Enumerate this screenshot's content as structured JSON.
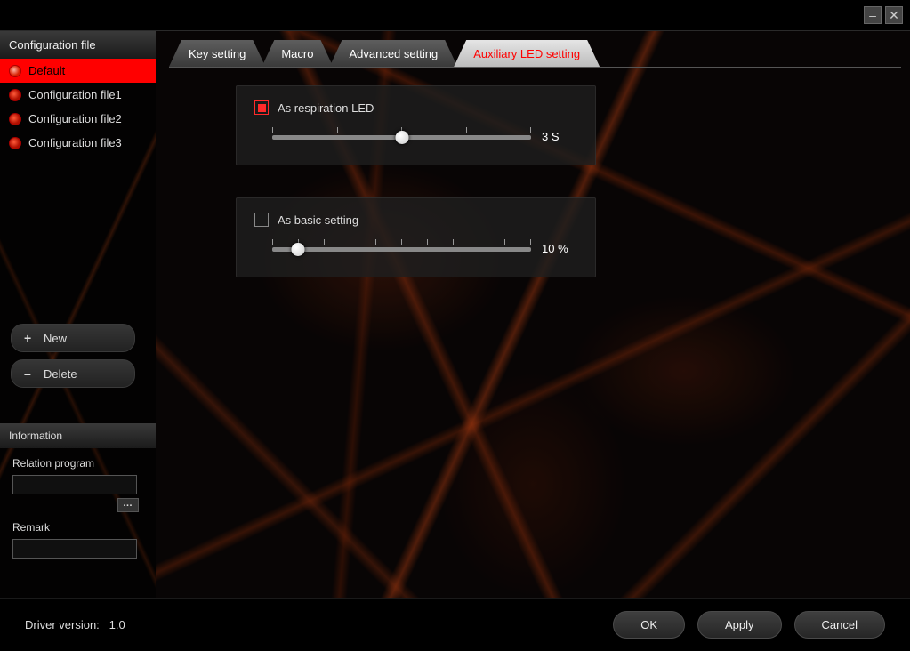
{
  "titlebar": {
    "minimize": "–",
    "close": "✕"
  },
  "sidebar": {
    "header": "Configuration file",
    "items": [
      {
        "label": "Default"
      },
      {
        "label": "Configuration file1"
      },
      {
        "label": "Configuration file2"
      },
      {
        "label": "Configuration file3"
      }
    ],
    "new_label": "New",
    "delete_label": "Delete",
    "info_header": "Information",
    "relation_label": "Relation program",
    "relation_value": "",
    "more": "…",
    "remark_label": "Remark",
    "remark_value": ""
  },
  "tabs": [
    {
      "label": "Key setting"
    },
    {
      "label": "Macro"
    },
    {
      "label": "Advanced setting"
    },
    {
      "label": "Auxiliary LED setting"
    }
  ],
  "led": {
    "respiration_label": "As respiration LED",
    "respiration_checked": true,
    "respiration_value": "3 S",
    "respiration_pct": 50,
    "respiration_ticks": 5,
    "basic_label": "As basic setting",
    "basic_checked": false,
    "basic_value": "10 %",
    "basic_pct": 10,
    "basic_ticks": 11
  },
  "footer": {
    "driver_label": "Driver version:",
    "driver_value": "1.0",
    "ok": "OK",
    "apply": "Apply",
    "cancel": "Cancel"
  }
}
